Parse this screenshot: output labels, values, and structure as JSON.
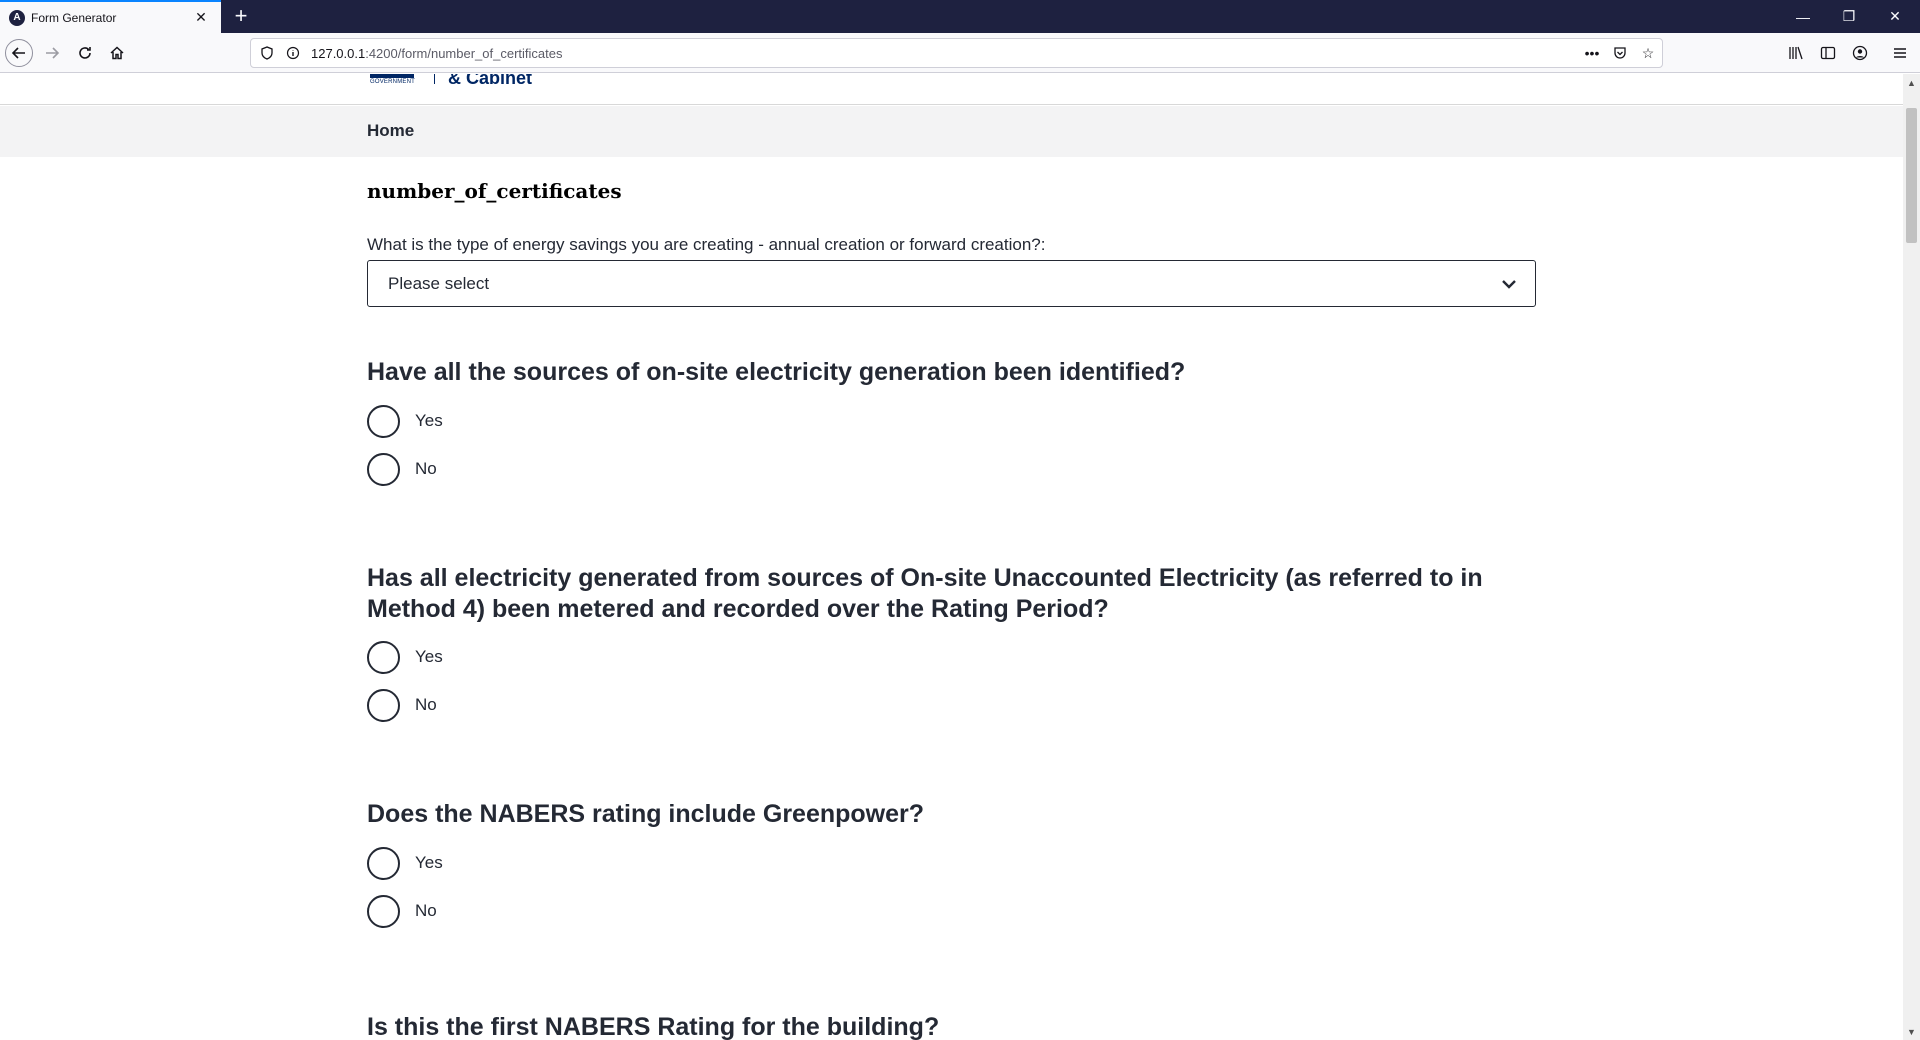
{
  "browser": {
    "tab_title": "Form Generator",
    "tab_favicon": "A",
    "url_host": "127.0.0.1",
    "url_path": ":4200/form/number_of_certificates",
    "icons": {
      "back": "arrow-left-icon",
      "forward": "arrow-right-icon",
      "reload": "reload-icon",
      "home": "home-icon",
      "shield": "shield-icon",
      "info": "info-icon",
      "more": "more-dots-icon",
      "pocket": "pocket-icon",
      "bookmark": "star-icon",
      "library": "library-icon",
      "sidebar": "sidebar-icon",
      "account": "account-icon",
      "menu": "hamburger-icon"
    }
  },
  "site": {
    "logo_gov_small": "GOVERNMENT",
    "logo_dept": "& Cabinet",
    "menu_home": "Home",
    "brand_color": "#002664"
  },
  "form": {
    "title": "number_of_certificates",
    "select_label": "What is the type of energy savings you are creating - annual creation or forward creation?:",
    "select_value": "Please select",
    "questions": [
      {
        "text": "Have all the sources of on-site electricity generation been identified?",
        "options": [
          "Yes",
          "No"
        ]
      },
      {
        "text": "Has all electricity generated from sources of On-site Unaccounted Electricity (as referred to in Method 4) been metered and recorded over the Rating Period?",
        "options": [
          "Yes",
          "No"
        ]
      },
      {
        "text": "Does the NABERS rating include Greenpower?",
        "options": [
          "Yes",
          "No"
        ]
      },
      {
        "text": "Is this the first NABERS Rating for the building?",
        "options": []
      }
    ]
  }
}
